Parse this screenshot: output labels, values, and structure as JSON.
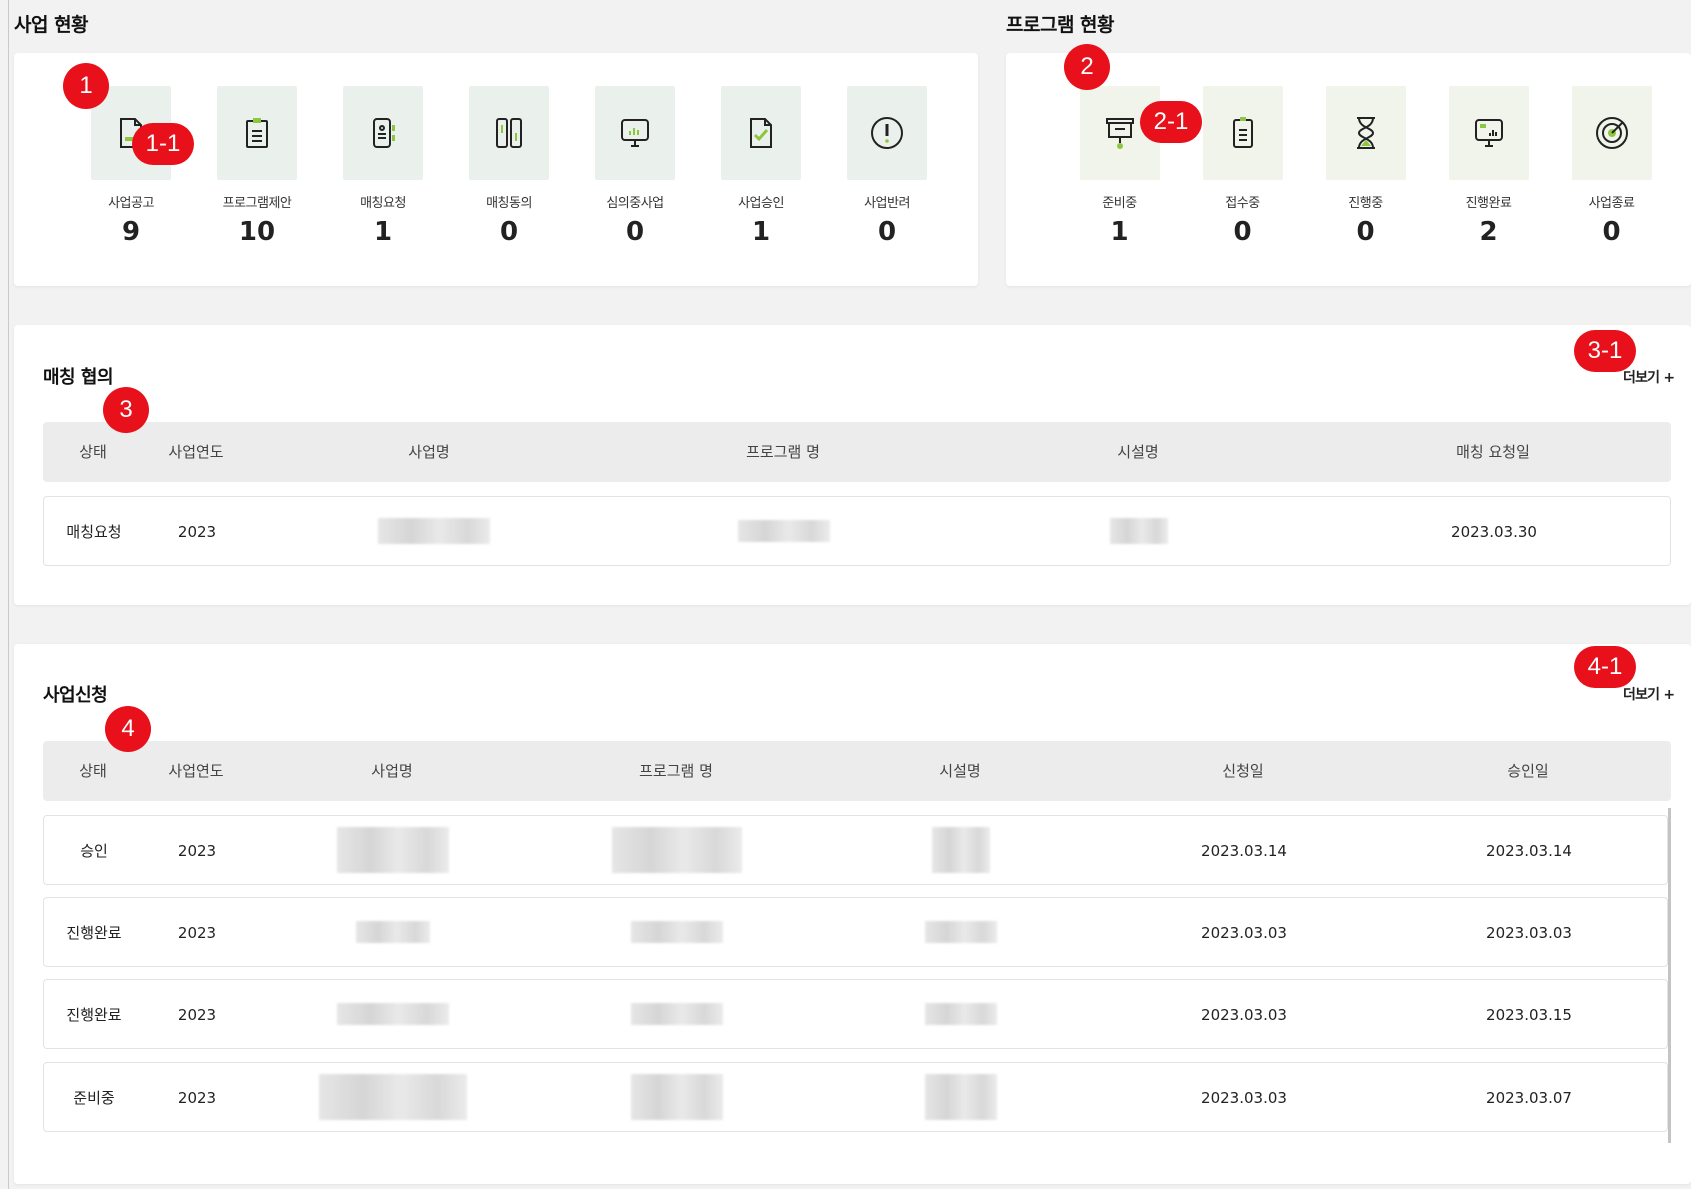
{
  "business_status": {
    "title": "사업 현황",
    "items": [
      {
        "label": "사업공고",
        "count": "9",
        "icon": "document-icon"
      },
      {
        "label": "프로그램제안",
        "count": "10",
        "icon": "clipboard-icon"
      },
      {
        "label": "매칭요청",
        "count": "1",
        "icon": "phone-icon"
      },
      {
        "label": "매칭동의",
        "count": "0",
        "icon": "panels-icon"
      },
      {
        "label": "심의중사업",
        "count": "0",
        "icon": "monitor-chart-icon"
      },
      {
        "label": "사업승인",
        "count": "1",
        "icon": "document-check-icon"
      },
      {
        "label": "사업반려",
        "count": "0",
        "icon": "exclamation-icon"
      }
    ]
  },
  "program_status": {
    "title": "프로그램 현황",
    "items": [
      {
        "label": "준비중",
        "count": "1",
        "icon": "projector-icon"
      },
      {
        "label": "접수중",
        "count": "0",
        "icon": "clipboard-list-icon"
      },
      {
        "label": "진행중",
        "count": "0",
        "icon": "hourglass-icon"
      },
      {
        "label": "진행완료",
        "count": "2",
        "icon": "board-chart-icon"
      },
      {
        "label": "사업종료",
        "count": "0",
        "icon": "target-icon"
      }
    ]
  },
  "matching": {
    "title": "매칭 협의",
    "more": "더보기 +",
    "columns": [
      "상태",
      "사업연도",
      "사업명",
      "프로그램 명",
      "시설명",
      "매칭 요청일"
    ],
    "rows": [
      {
        "status": "매칭요청",
        "year": "2023",
        "date": "2023.03.30"
      }
    ]
  },
  "application": {
    "title": "사업신청",
    "more": "더보기 +",
    "columns": [
      "상태",
      "사업연도",
      "사업명",
      "프로그램 명",
      "시설명",
      "신청일",
      "승인일"
    ],
    "rows": [
      {
        "status": "승인",
        "year": "2023",
        "applied": "2023.03.14",
        "approved": "2023.03.14"
      },
      {
        "status": "진행완료",
        "year": "2023",
        "applied": "2023.03.03",
        "approved": "2023.03.03"
      },
      {
        "status": "진행완료",
        "year": "2023",
        "applied": "2023.03.03",
        "approved": "2023.03.15"
      },
      {
        "status": "준비중",
        "year": "2023",
        "applied": "2023.03.03",
        "approved": "2023.03.07"
      }
    ]
  },
  "annotations": [
    "1",
    "1-1",
    "2",
    "2-1",
    "3",
    "3-1",
    "4",
    "4-1"
  ],
  "colors": {
    "accent_green": "#8dc63f",
    "badge_red": "#e8101a",
    "icon_bg_green": "#eaf0ec",
    "icon_bg_cream": "#f1f4ea"
  }
}
